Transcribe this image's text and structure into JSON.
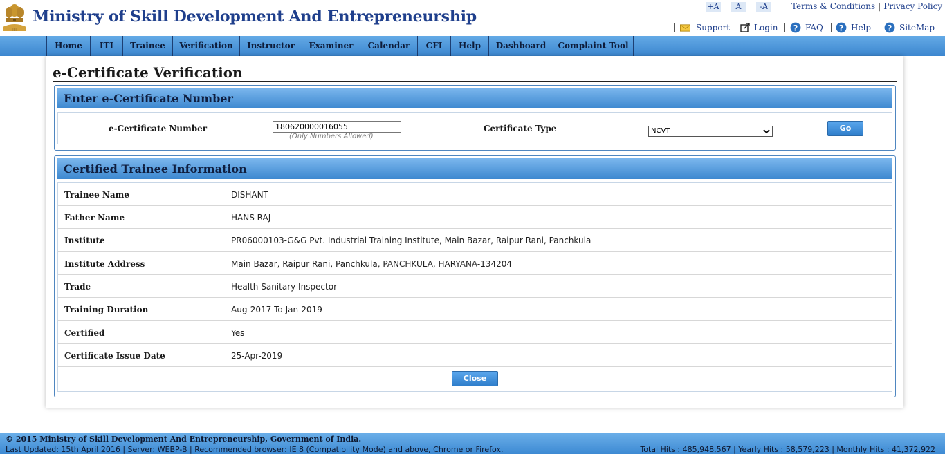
{
  "header": {
    "title": "Ministry of Skill Development And Entrepreneurship",
    "emblem_icon": "national-emblem-icon",
    "font_buttons": [
      "+A",
      "A",
      "-A"
    ],
    "links": {
      "terms": "Terms & Conditions",
      "privacy": "Privacy Policy"
    },
    "utility": [
      {
        "label": "Support",
        "icon": "mail-icon"
      },
      {
        "label": "Login",
        "icon": "external-login-icon"
      },
      {
        "label": "FAQ",
        "icon": "help-circle-icon"
      },
      {
        "label": "Help",
        "icon": "help-circle-icon"
      },
      {
        "label": "SiteMap",
        "icon": "help-circle-icon"
      }
    ]
  },
  "nav": [
    "Home",
    "ITI",
    "Trainee",
    "Verification",
    "Instructor",
    "Examiner",
    "Calendar",
    "CFI",
    "Help",
    "Dashboard",
    "Complaint Tool"
  ],
  "page": {
    "title": "e-Certificate Verification",
    "entry_panel": {
      "heading": "Enter e-Certificate Number",
      "number_label": "e-Certificate Number",
      "number_value": "180620000016055",
      "number_hint": "(Only Numbers Allowed)",
      "type_label": "Certificate Type",
      "type_selected": "NCVT",
      "go_label": "Go"
    },
    "info_panel": {
      "heading": "Certified Trainee Information",
      "rows": [
        {
          "label": "Trainee Name",
          "value": "DISHANT"
        },
        {
          "label": "Father Name",
          "value": "HANS RAJ"
        },
        {
          "label": "Institute",
          "value": "PR06000103-G&G Pvt. Industrial Training Institute, Main Bazar, Raipur Rani, Panchkula"
        },
        {
          "label": "Institute Address",
          "value": "Main Bazar, Raipur Rani, Panchkula, PANCHKULA, HARYANA-134204"
        },
        {
          "label": "Trade",
          "value": "Health Sanitary Inspector"
        },
        {
          "label": "Training Duration",
          "value": "Aug-2017 To Jan-2019"
        },
        {
          "label": "Certified",
          "value": "Yes"
        },
        {
          "label": "Certificate Issue Date",
          "value": "25-Apr-2019"
        }
      ],
      "close_label": "Close"
    }
  },
  "footer": {
    "copyright": "© 2015 Ministry of Skill Development And Entrepreneurship, Government of India.",
    "updated": "Last Updated: 15th April 2016 | Server: WEBP-B | Recommended browser: IE 8 (Compatibility Mode) and above, Chrome or Firefox.",
    "hits": "Total Hits : 485,948,567 | Yearly Hits : 58,579,223 | Monthly Hits : 41,372,922"
  },
  "colors": {
    "brand_blue": "#1f3f8c",
    "nav_blue": "#4a95d9",
    "panel_border": "#4f86c0"
  }
}
